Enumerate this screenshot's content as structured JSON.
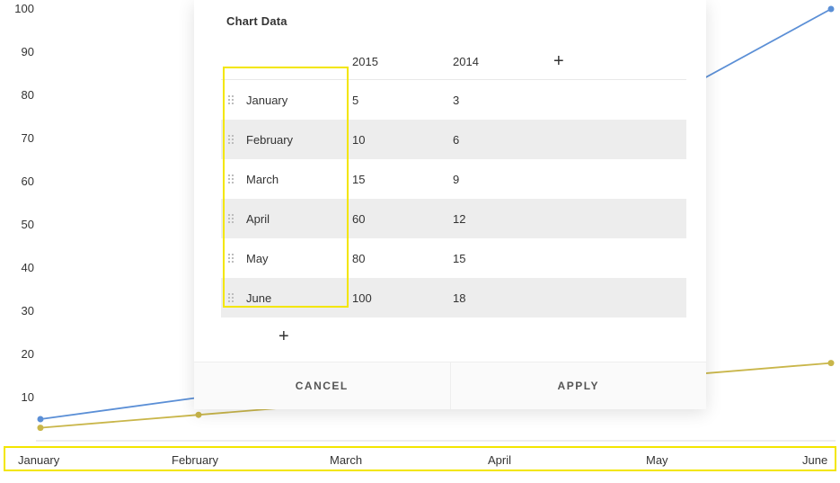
{
  "dialog": {
    "title": "Chart Data",
    "columns": [
      "2015",
      "2014"
    ],
    "rows": [
      {
        "cat": "January",
        "vals": [
          "5",
          "3"
        ]
      },
      {
        "cat": "February",
        "vals": [
          "10",
          "6"
        ]
      },
      {
        "cat": "March",
        "vals": [
          "15",
          "9"
        ]
      },
      {
        "cat": "April",
        "vals": [
          "60",
          "12"
        ]
      },
      {
        "cat": "May",
        "vals": [
          "80",
          "15"
        ]
      },
      {
        "cat": "June",
        "vals": [
          "100",
          "18"
        ]
      }
    ],
    "cancel_label": "CANCEL",
    "apply_label": "APPLY",
    "add_col_glyph": "+",
    "add_row_glyph": "+"
  },
  "chart_data": {
    "type": "line",
    "categories": [
      "January",
      "February",
      "March",
      "April",
      "May",
      "June"
    ],
    "series": [
      {
        "name": "2015",
        "values": [
          5,
          10,
          15,
          60,
          80,
          100
        ],
        "color": "#5b8fd6"
      },
      {
        "name": "2014",
        "values": [
          3,
          6,
          9,
          12,
          15,
          18
        ],
        "color": "#c9b64a"
      }
    ],
    "y_ticks": [
      10,
      20,
      30,
      40,
      50,
      60,
      70,
      80,
      90,
      100
    ],
    "ylim": [
      0,
      100
    ],
    "xlabel": "",
    "ylabel": ""
  }
}
